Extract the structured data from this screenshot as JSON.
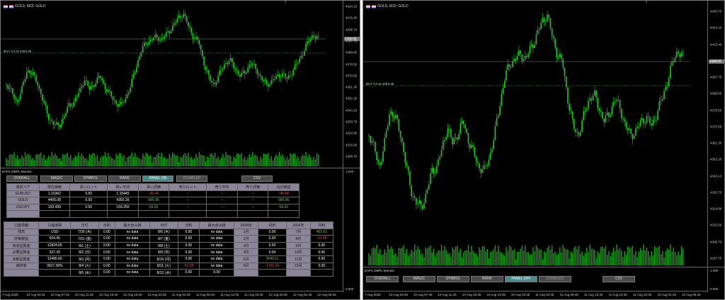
{
  "left": {
    "title": "GOLD, M15: GOLD",
    "buy_label": "BUY 0.5 at 4393.39",
    "axis": [
      "4424.10",
      "4415.40",
      "4406.70",
      "4397.75",
      "4388.80",
      "4379.50",
      "4370.55",
      "4361.30",
      "4352.20",
      "4343.10",
      "4333.75",
      "4324.90",
      "4315.60",
      "4306.70"
    ],
    "price_tag": "4406.08",
    "subwin_label": "EAFC DMPL Monitor",
    "sub_max": "1.000",
    "sub_min": "0.000",
    "time": [
      "7 Aug 2026",
      "10 Aug 03:45",
      "10 Aug 07:45",
      "10 Aug 11:45",
      "10 Aug 15:45",
      "10 Aug 19:45",
      "10 Aug 23:45",
      "11 Aug 04:45",
      "11 Aug 08:45",
      "11 Aug 12:45",
      "11 Aug 16:45",
      "11 Aug 20:45",
      "12 Aug 01:45",
      "12 Aug 05:45"
    ],
    "buttons": [
      "OVERALL",
      "MAGIC",
      "SYMBOL",
      "RANK",
      "PANEL ON",
      "DISABLED",
      "CSV"
    ],
    "t1": {
      "head": [
        "通貨ペア",
        "現在価格",
        "買いロット",
        "買い平均",
        "買い評価",
        "売りロット",
        "売り平均",
        "売り評価",
        "合計損益"
      ],
      "rows": [
        [
          "EURUSD",
          "1.15362",
          "0.50",
          "1.15445",
          "-45.44",
          "-",
          "-",
          "-",
          "-45.44"
        ],
        [
          "GOLD",
          "4406.08",
          "0.50",
          "4393.39",
          "589.96",
          "-",
          "-",
          "-",
          "589.96"
        ],
        [
          "USDJPY",
          "159.439",
          "0.50",
          "159.250",
          "59.93",
          "-",
          "-",
          "-",
          "59.93"
        ],
        [
          "",
          "",
          "",
          "",
          "",
          "",
          "",
          "",
          ""
        ]
      ]
    },
    "t2": {
      "head": [
        "口座情報",
        "口座通貨",
        "日付",
        "日利",
        "最大含み損",
        "日付",
        "日利",
        "最大含み損",
        "2026年",
        "月利",
        "2026年",
        "月利"
      ],
      "rows": [
        [
          "残高",
          "USD",
          "7/30 (木)",
          "0.00",
          "no data",
          "8/6 (木)",
          "0.00",
          "no data",
          "1月",
          "0.00",
          "7月",
          "462.61"
        ],
        [
          "評価損益",
          "604.45",
          "7/31 (金)",
          "0.00",
          "no data",
          "8/7 (金)",
          "0.00",
          "no data",
          "2月",
          "0.00",
          "8月",
          "-91.58"
        ],
        [
          "有効証拠金",
          "12824.05",
          "8/1 (土)",
          "0.00",
          "no data",
          "8/8 (土)",
          "0.00",
          "no data",
          "3月",
          "0.00",
          "9月",
          "0.00"
        ],
        [
          "必要証拠金",
          "327.39",
          "8/2 (日)",
          "0.00",
          "no data",
          "8/9 (日)",
          "0.00",
          "no data",
          "4月",
          "0.00",
          "10月",
          "0.00"
        ],
        [
          "余剰証拠金",
          "12496.66",
          "8/3 (月)",
          "0.00",
          "no data",
          "8/10 (月)",
          "0.00",
          "no data",
          "5月",
          "3640.11",
          "11月",
          "0.00"
        ],
        [
          "維持率",
          "3917.06%",
          "8/4 (火)",
          "0.00",
          "no data",
          "8/11 (火)",
          "-91.58",
          "no data",
          "6月",
          "-1791.34",
          "12月",
          "0.00"
        ],
        [
          "",
          "",
          "8/5 (水)",
          "0.00",
          "no data",
          "8/12 (水)",
          "0.00",
          "0.00",
          "",
          "",
          "",
          ""
        ]
      ]
    }
  },
  "right": {
    "title": "GOLD, M15: GOLD",
    "buy_label": "BUY 0.5 at 4393.39",
    "axis": [
      "4433.75",
      "4424.10",
      "4415.40",
      "4406.70",
      "4397.75",
      "4388.80",
      "4379.50",
      "4370.55",
      "4361.30",
      "4352.20",
      "4343.10",
      "4333.75",
      "4324.90",
      "4315.60",
      "4306.70",
      "4297.75"
    ],
    "price_tag": "4406.08",
    "subwin_label": "EAFC DMPL Monitor",
    "sub_max": "1.000",
    "sub_min": "0.000",
    "time": [
      "7 Aug 2026",
      "10 Aug 03:45",
      "10 Aug 07:45",
      "10 Aug 11:45",
      "10 Aug 15:45",
      "10 Aug 19:45",
      "10 Aug 23:45",
      "11 Aug 04:45",
      "11 Aug 08:45",
      "11 Aug 12:45",
      "11 Aug 16:45",
      "11 Aug 20:45",
      "12 Aug 01:45",
      "12 Aug 05:45"
    ],
    "buttons": [
      "OVERALL",
      "MAGIC",
      "SYMBOL",
      "RANK",
      "PANEL OFF",
      "DISABLED",
      "CSV"
    ]
  },
  "colors": {
    "candle": "#22cc22",
    "grid": "#444",
    "volume": "#1e9e1e",
    "buyline": "#2e8b2e"
  }
}
